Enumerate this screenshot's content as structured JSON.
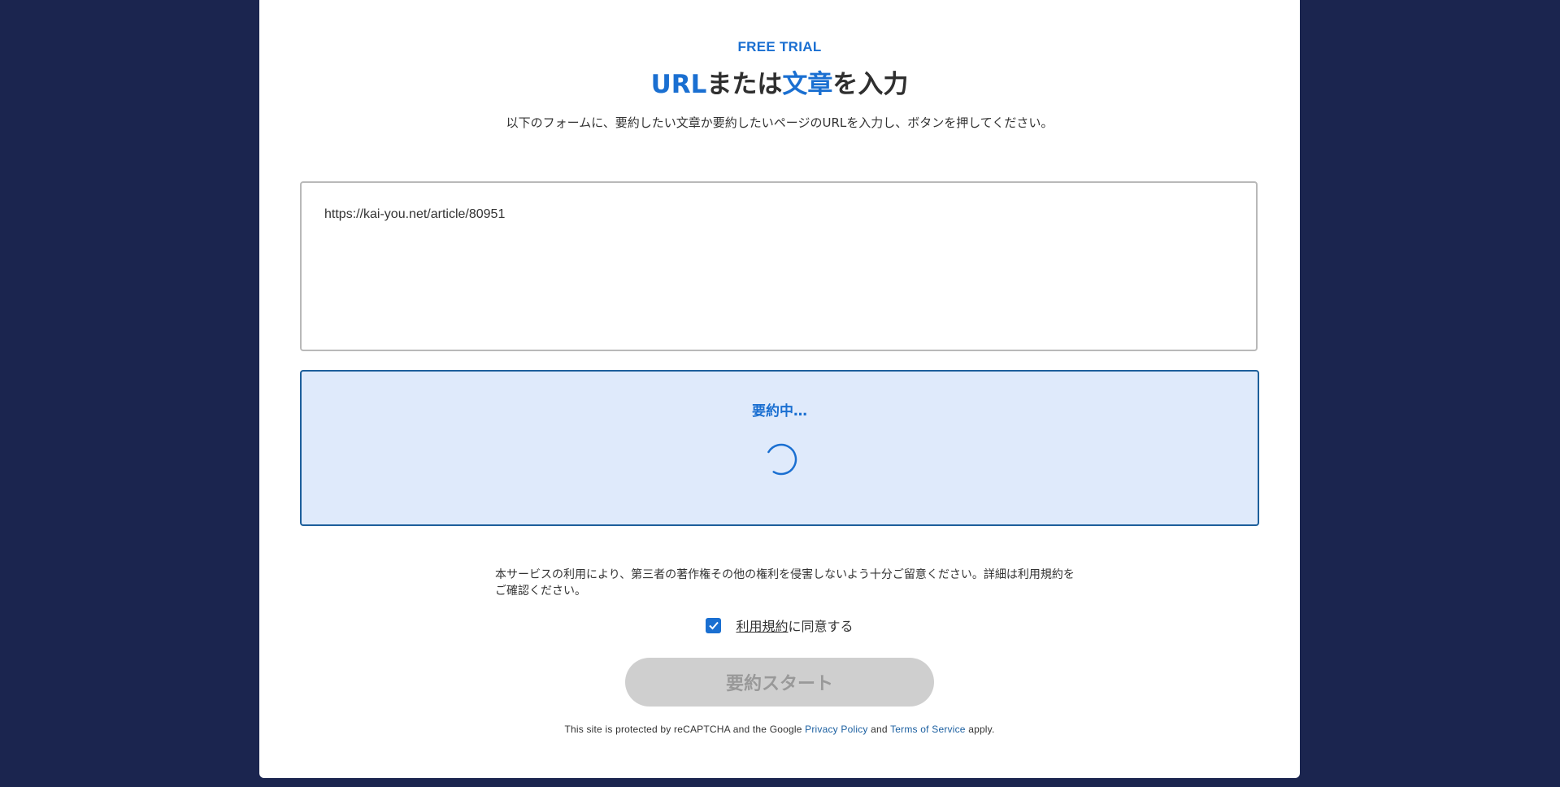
{
  "header": {
    "eyebrow": "FREE TRIAL",
    "title_part1": "URL",
    "title_part2": "または",
    "title_part3": "文章",
    "title_part4": "を入力",
    "subtitle": "以下のフォームに、要約したい文章か要約したいページのURLを入力し、ボタンを押してください。"
  },
  "input": {
    "value": "https://kai-you.net/article/80951"
  },
  "status": {
    "text": "要約中…"
  },
  "notice": {
    "text": "本サービスの利用により、第三者の著作権その他の権利を侵害しないよう十分ご留意ください。詳細は利用規約をご確認ください。"
  },
  "agree": {
    "checked": true,
    "link_label": "利用規約",
    "suffix": "に同意する"
  },
  "start_button": {
    "label": "要約スタート"
  },
  "recaptcha": {
    "prefix": "This site is protected by reCAPTCHA and the Google ",
    "privacy_label": "Privacy Policy",
    "and": " and ",
    "terms_label": "Terms of Service",
    "suffix": " apply."
  },
  "colors": {
    "background": "#1b254f",
    "accent": "#1a6fd1",
    "status_bg": "#dfeafb",
    "button_disabled": "#cfcfcf"
  }
}
